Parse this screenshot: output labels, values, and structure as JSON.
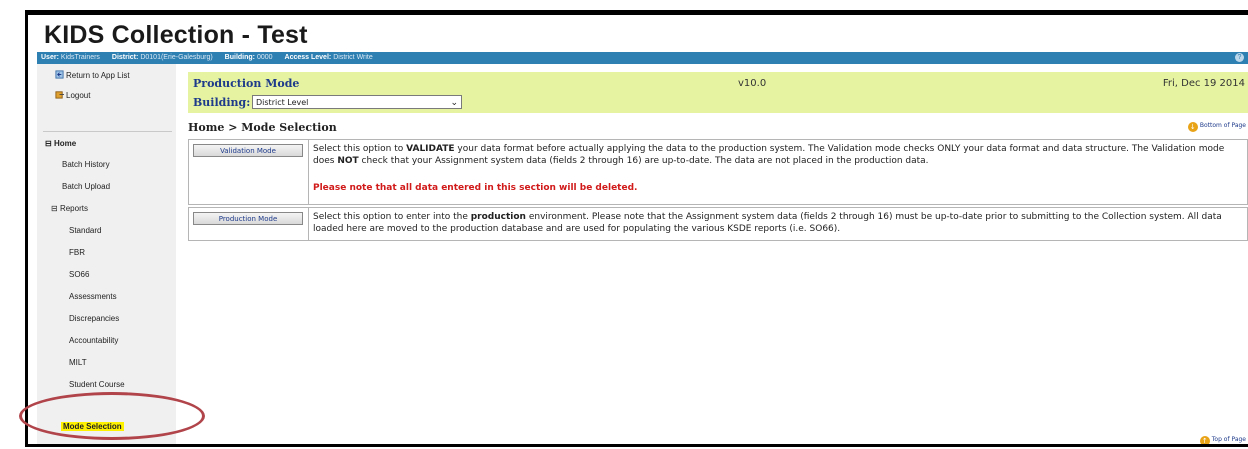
{
  "app": {
    "title": "KIDS Collection - Test"
  },
  "userbar": {
    "user_label": "User:",
    "user": "KidsTrainers",
    "district_label": "District:",
    "district": "D0101(Erie-Galesburg)",
    "building_label": "Building:",
    "building": "0000",
    "access_label": "Access Level:",
    "access": "District Write",
    "help_icon": "help-icon"
  },
  "sidebar": {
    "return_link": "Return to App List",
    "logout_link": "Logout",
    "home": "Home",
    "batch_history": "Batch History",
    "batch_upload": "Batch Upload",
    "reports": "Reports",
    "report_items": [
      "Standard",
      "FBR",
      "SO66",
      "Assessments",
      "Discrepancies",
      "Accountability",
      "MILT",
      "Student Course"
    ],
    "mode_selection": "Mode Selection"
  },
  "modebar": {
    "title": "Production Mode",
    "version": "v10.0",
    "date": "Fri, Dec 19 2014",
    "building_label": "Building:",
    "building_value": "District Level"
  },
  "breadcrumb": "Home > Mode Selection",
  "links": {
    "bottom": "Bottom of Page",
    "top": "Top of Page"
  },
  "options": {
    "validation": {
      "button": "Validation Mode",
      "t1": "Select this option to ",
      "b1": "VALIDATE",
      "t2": " your data format before actually applying the data to the production system. The Validation mode checks ONLY your data format and data structure. The Validation mode does ",
      "b2": "NOT",
      "t3": " check that your Assignment system data (fields 2 through 16) are up-to-date. The data are not placed in the production data.",
      "warning": "Please note that all data entered in this section will be deleted."
    },
    "production": {
      "button": "Production Mode",
      "t1": "Select this option to enter into the ",
      "b1": "production",
      "t2": " environment. Please note that the Assignment system data (fields 2 through 16) must be up-to-date prior to submitting to the Collection system. All data loaded here are moved to the production database and are used for populating the various KSDE reports (i.e. SO66)."
    }
  },
  "colors": {
    "userbar": "#2e7fb2",
    "modebar": "#e6f4a2",
    "highlight": "#fff200",
    "ring": "#b0444a",
    "warning": "#d11a1a"
  }
}
